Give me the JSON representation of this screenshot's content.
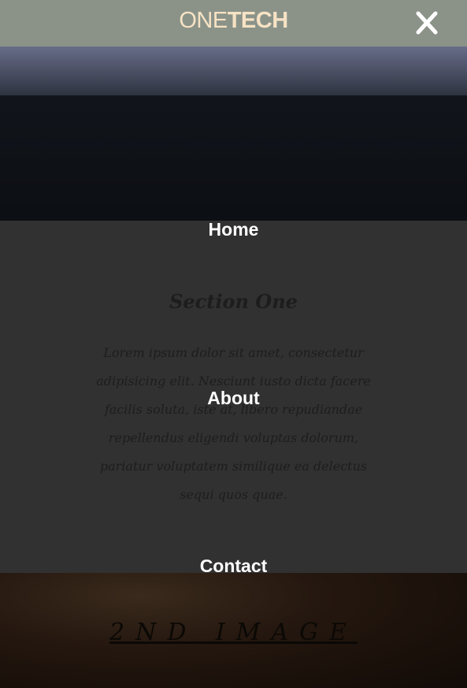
{
  "brand": {
    "part1": "ONE",
    "part2": "TECH"
  },
  "nav": {
    "close_icon": "close-icon",
    "items": [
      {
        "label": "Home"
      },
      {
        "label": "About"
      },
      {
        "label": "Contact"
      }
    ]
  },
  "section": {
    "title": "Section One",
    "body": "Lorem ipsum dolor sit amet, consectetur adipisicing elit. Nesciunt iusto dicta facere facilis soluta, iste at, libero repudiandae repellendus eligendi voluptas dolorum, pariatur voluptatem similique ea delectus sequi quos quae."
  },
  "image2": {
    "label": "2ND IMAGE"
  },
  "colors": {
    "topbar": "#8b9389",
    "brand": "#f6e2c4",
    "overlay": "#313131",
    "nav_text": "#ffffff"
  }
}
